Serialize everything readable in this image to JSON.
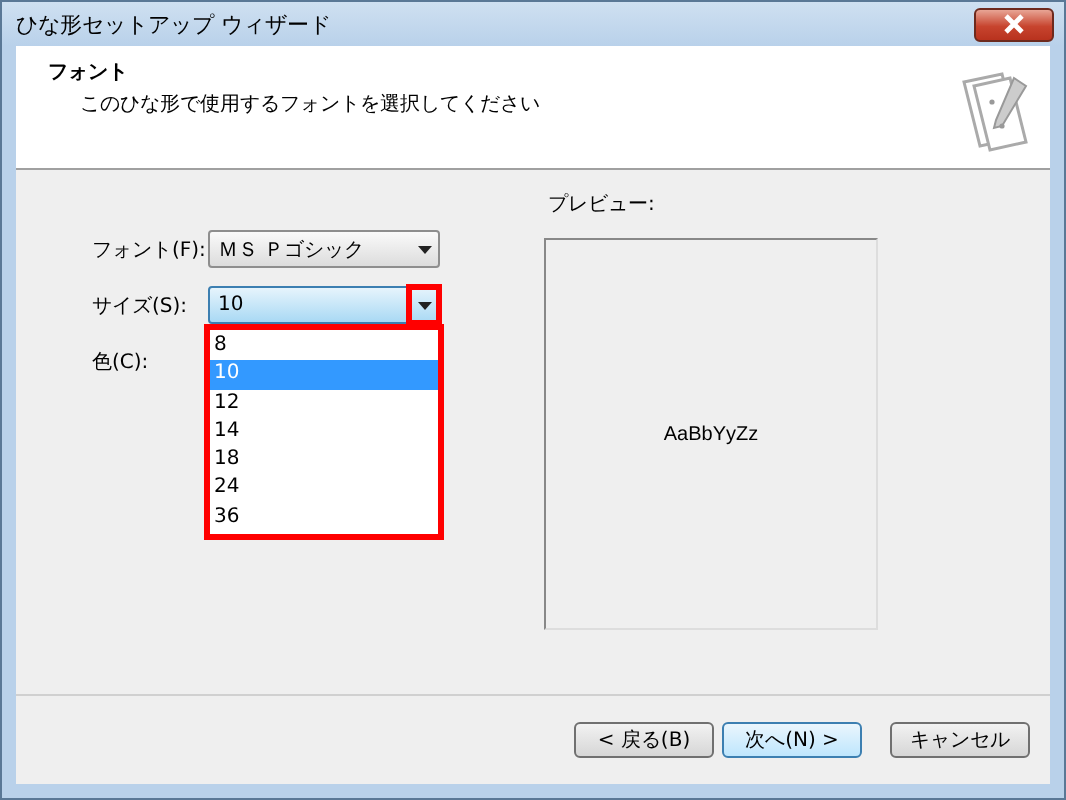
{
  "window": {
    "title": "ひな形セットアップ ウィザード"
  },
  "header": {
    "title": "フォント",
    "subtitle": "このひな形で使用するフォントを選択してください"
  },
  "fields": [
    {
      "label": "フォント(F):",
      "value": "ＭＳ Ｐゴシック",
      "kind": "combo",
      "highlighted": false,
      "open": false
    },
    {
      "label": "サイズ(S):",
      "value": "10",
      "kind": "combo",
      "highlighted": true,
      "open": true
    },
    {
      "label": "色(C):",
      "kind": "color"
    }
  ],
  "size_list": {
    "highlighted": true,
    "items": [
      {
        "label": "8",
        "selected": false
      },
      {
        "label": "10",
        "selected": true
      },
      {
        "label": "12",
        "selected": false
      },
      {
        "label": "14",
        "selected": false
      },
      {
        "label": "18",
        "selected": false
      },
      {
        "label": "24",
        "selected": false
      },
      {
        "label": "36",
        "selected": false
      }
    ]
  },
  "preview": {
    "label": "プレビュー:",
    "sample": "AaBbYyZz"
  },
  "buttons": [
    {
      "label": "< 戻る(B)",
      "default": false
    },
    {
      "label": "次へ(N) >",
      "default": true
    },
    {
      "label": "キャンセル",
      "default": false
    }
  ]
}
